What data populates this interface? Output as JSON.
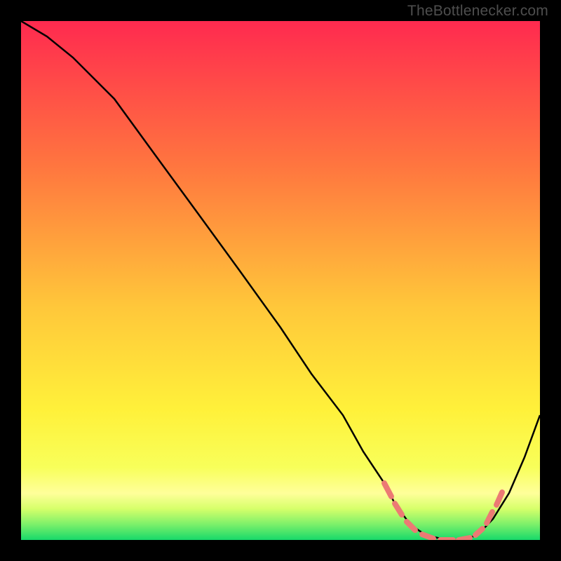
{
  "watermark": "TheBottlenecker.com",
  "chart_data": {
    "type": "line",
    "title": "",
    "xlabel": "",
    "ylabel": "",
    "xlim": [
      0,
      100
    ],
    "ylim": [
      0,
      100
    ],
    "gradient_background": {
      "top": "#ff2a4f",
      "mid1": "#ff8a39",
      "mid2": "#ffe03a",
      "band": "#ffff8a",
      "bottom": "#17e06a"
    },
    "series": [
      {
        "name": "bottleneck-curve",
        "x": [
          0,
          5,
          10,
          18,
          26,
          34,
          42,
          50,
          56,
          62,
          66,
          70,
          72,
          75,
          78,
          82,
          85,
          88,
          91,
          94,
          97,
          100
        ],
        "y": [
          100,
          97,
          93,
          85,
          74,
          63,
          52,
          41,
          32,
          24,
          17,
          11,
          7,
          3,
          1,
          0,
          0,
          1,
          4,
          9,
          16,
          24
        ]
      }
    ],
    "annotations": {
      "type": "dashed-segment",
      "description": "salmon dashed overlay on valley bottom",
      "x": [
        70,
        72,
        75,
        78,
        80,
        82,
        84,
        86,
        88,
        90
      ],
      "y": [
        11,
        7,
        3,
        1,
        0,
        0,
        0,
        1,
        3,
        6
      ]
    }
  }
}
